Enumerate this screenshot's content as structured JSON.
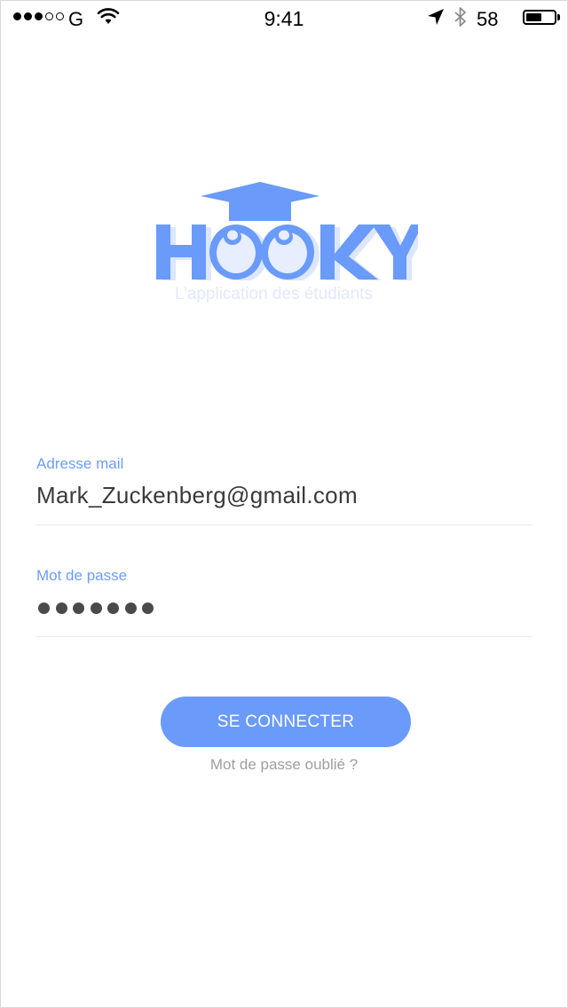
{
  "status_bar": {
    "signal_bars_filled": 3,
    "signal_bars_total": 5,
    "carrier": "G",
    "time": "9:41",
    "battery_percent": "58",
    "battery_level": 0.58,
    "icons": [
      "signal-dots",
      "wifi-icon",
      "location-arrow-icon",
      "bluetooth-icon",
      "battery-icon"
    ]
  },
  "logo": {
    "name": "HOOKY",
    "tagline": "L’application des étudiants",
    "colors": {
      "primary": "#6a9bfb",
      "shadow": "#dce7fd",
      "eye": "#e6eeff"
    }
  },
  "form": {
    "email_label": "Adresse mail",
    "email_value": "Mark_Zuckenberg@gmail.com",
    "password_label": "Mot de passe",
    "password_length": 7
  },
  "actions": {
    "login_label": "SE CONNECTER",
    "forgot_label": "Mot de passe oublié ?"
  },
  "colors": {
    "accent": "#6a9bfb",
    "label": "#6c9dfb",
    "text": "#3a3a3a",
    "muted": "#9e9e9e"
  }
}
